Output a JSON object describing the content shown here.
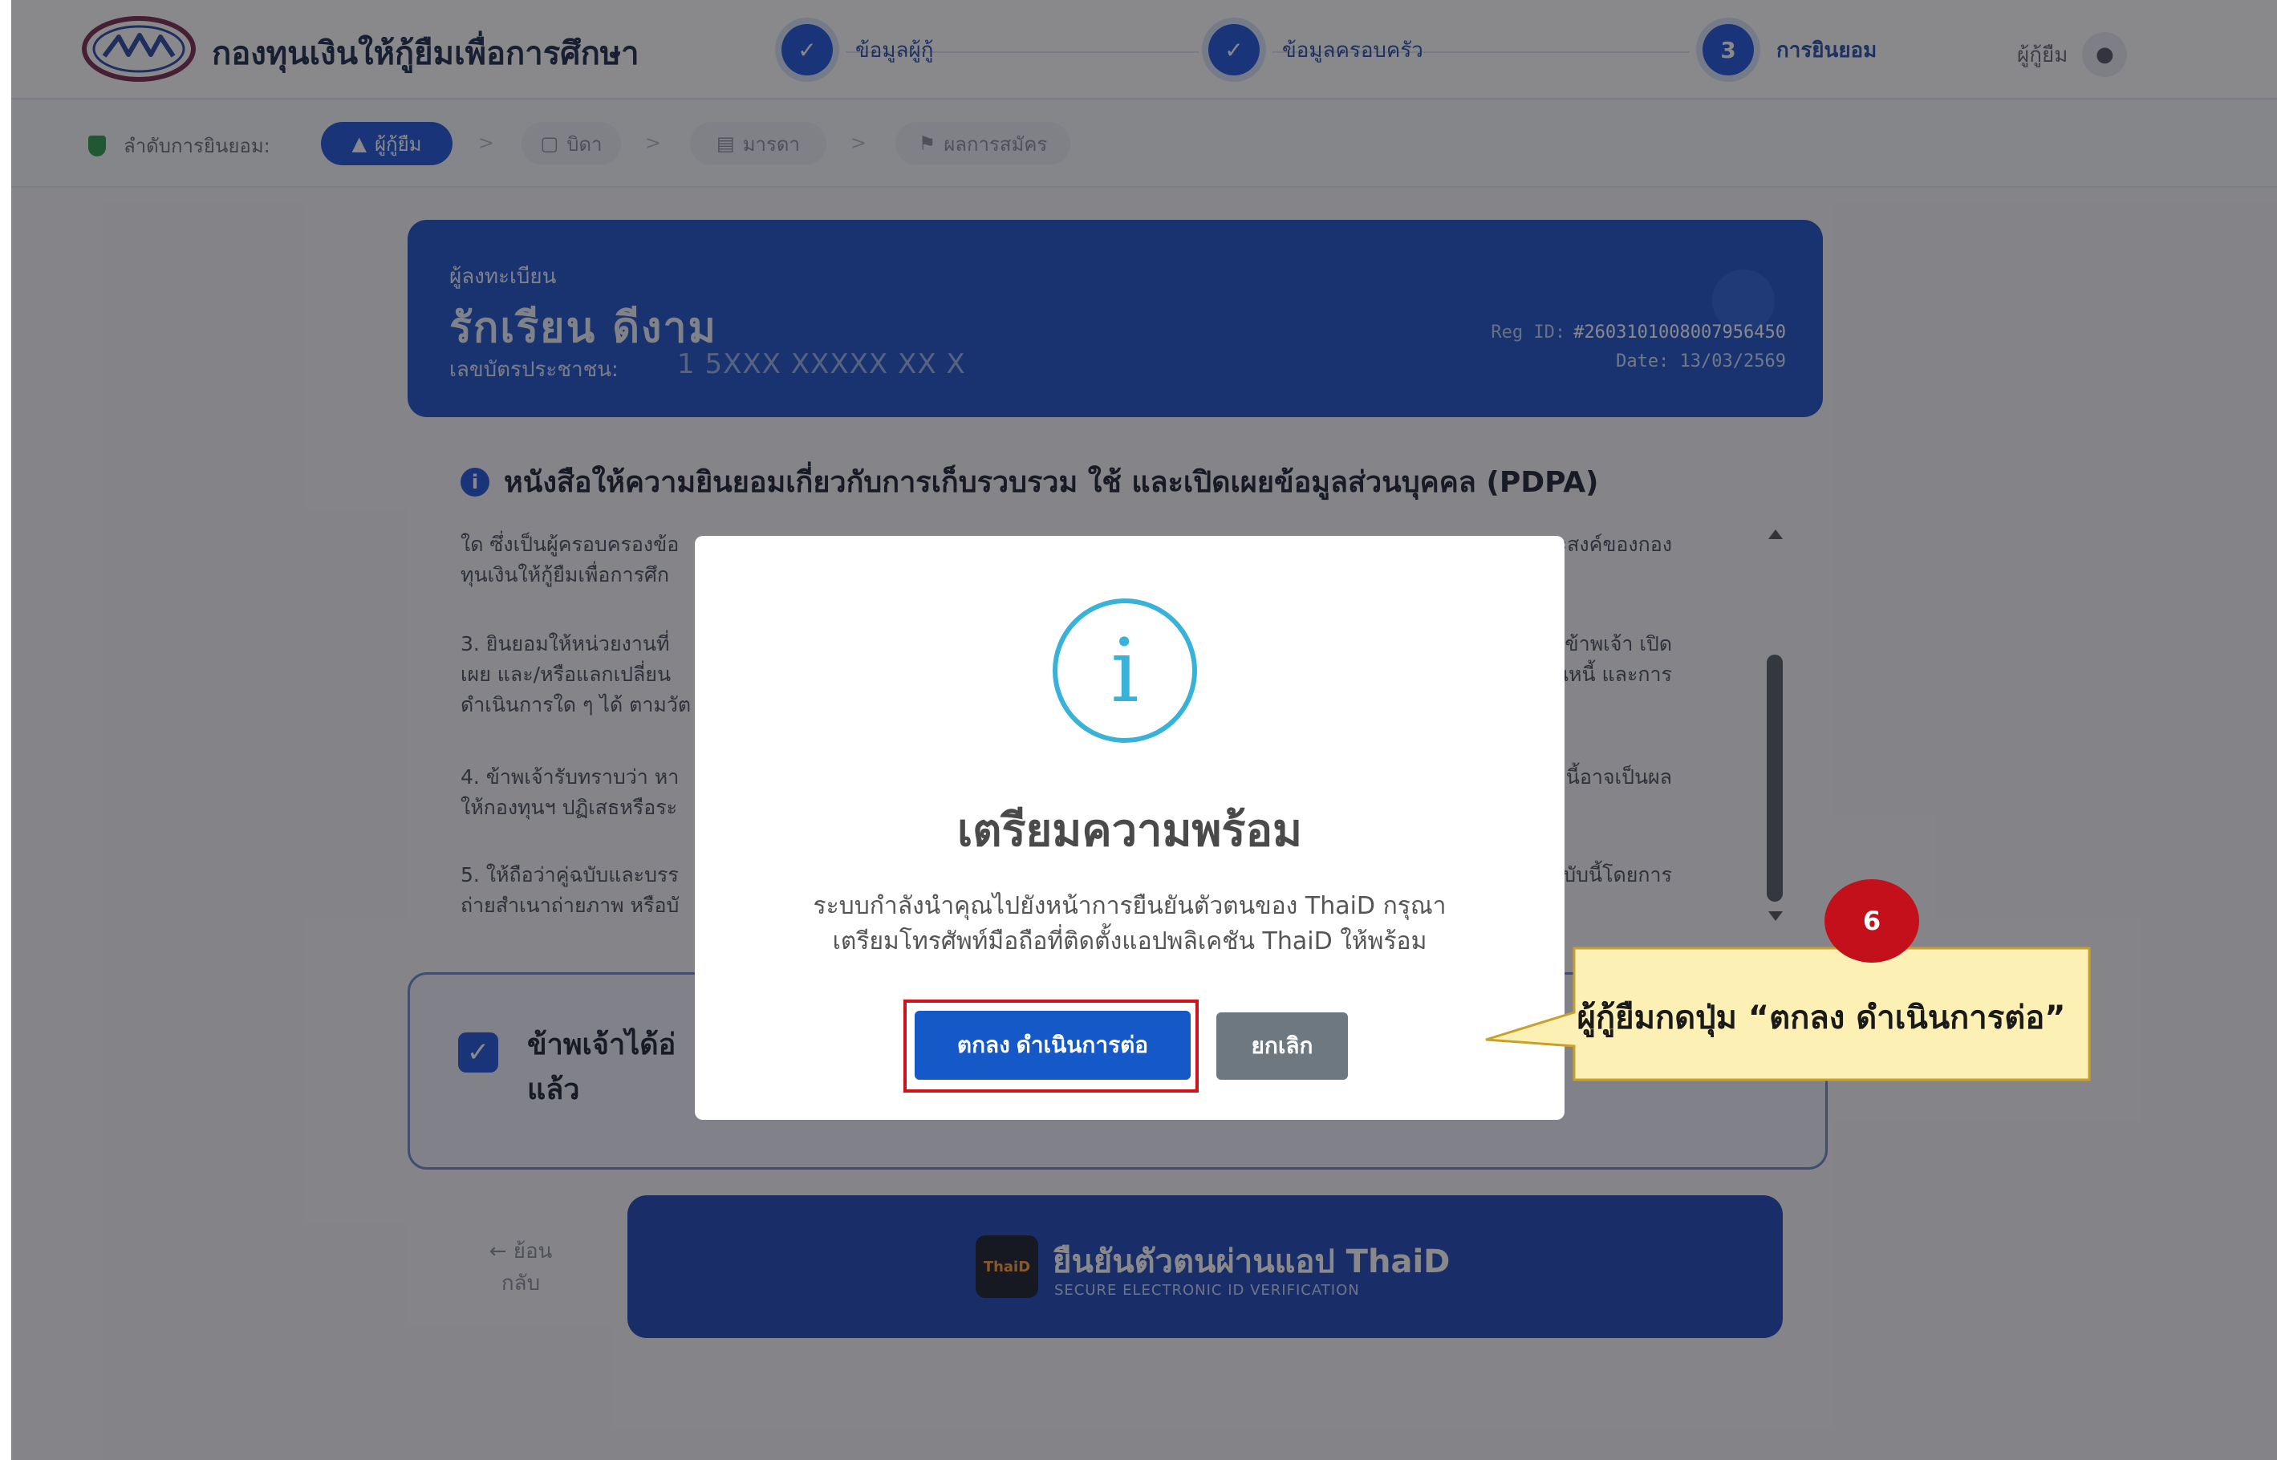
{
  "header": {
    "org_name": "กองทุนเงินให้กู้ยืมเพื่อการศึกษา",
    "steps": [
      {
        "marker": "✓",
        "label": "ข้อมูลผู้กู้"
      },
      {
        "marker": "✓",
        "label": "ข้อมูลครอบครัว"
      },
      {
        "marker": "3",
        "label": "การยินยอม"
      }
    ],
    "user_label": "ผู้กู้ยืม",
    "user_icon": "user-icon"
  },
  "subnav": {
    "label": "ลำดับการยินยอม:",
    "pills": [
      "ผู้กู้ยืม",
      "บิดา",
      "มารดา",
      "ผลการสมัคร"
    ],
    "pill_icons": [
      "user-icon",
      "calendar-icon",
      "id-card-icon",
      "flag-icon"
    ],
    "separator": ">"
  },
  "registrant": {
    "heading": "ผู้ลงทะเบียน",
    "name": "รักเรียน  ดีงาม",
    "id_label": "เลขบัตรประชาชน:",
    "id_value": "1 5XXX XXXXX XX X",
    "reg_id_label": "Reg ID:",
    "reg_id_value": "#2603101008007956450",
    "date": "Date: 13/03/2569"
  },
  "consent": {
    "title": "หนังสือให้ความยินยอมเกี่ยวกับการเก็บรวบรวม ใช้ และเปิดเผยข้อมูลส่วนบุคคล (PDPA)",
    "paragraphs": [
      {
        "left": [
          "ใด ซึ่งเป็นผู้ครอบครองข้อ",
          "ทุนเงินให้กู้ยืมเพื่อการศึก"
        ],
        "right": [
          "ประสงค์ของกอง"
        ]
      },
      {
        "left": [
          "3. ยินยอมให้หน่วยงานที่",
          "เผย และ/หรือแลกเปลี่ยน",
          "ดำเนินการใด ๆ ได้ ตามวัต"
        ],
        "right": [
          "ของข้าพเจ้า เปิด",
          "งานหนี้ และการ"
        ]
      },
      {
        "left": [
          "4. ข้าพเจ้ารับทราบว่า หา",
          "ให้กองทุนฯ ปฏิเสธหรือระ"
        ],
        "right": [
          "ฉบับนี้อาจเป็นผล"
        ]
      },
      {
        "left": [
          "5. ให้ถือว่าคู่ฉบับและบรร",
          "ถ่ายสำเนาถ่ายภาพ หรือบั"
        ],
        "right": [
          "มฉบับนี้โดยการ"
        ]
      }
    ],
    "agree_text": "ข้าพเจ้าได้อ่ แล้ว"
  },
  "footer": {
    "back_label": "← ย้อนกลับ",
    "thaid_logo": "ThaiD",
    "thaid_main": "ยืนยันตัวตนผ่านแอป ThaiD",
    "thaid_sub": "SECURE ELECTRONIC ID VERIFICATION"
  },
  "modal": {
    "icon": "info-icon",
    "icon_glyph": "i",
    "title": "เตรียมความพร้อม",
    "body_line1": "ระบบกำลังนำคุณไปยังหน้าการยืนยันตัวตนของ ThaiD กรุณา",
    "body_line2": "เตรียมโทรศัพท์มือถือที่ติดตั้งแอปพลิเคชัน ThaiD ให้พร้อม",
    "confirm_label": "ตกลง ดำเนินการต่อ",
    "cancel_label": "ยกเลิก"
  },
  "annotation": {
    "step_number": "6",
    "callout_text": "ผู้กู้ยืมกดปุ่ม “ตกลง ดำเนินการต่อ”"
  },
  "colors": {
    "primary": "#1f55d6",
    "card": "#1f52c9",
    "info": "#38b2d8",
    "highlight": "#d2121b",
    "callout_fill": "#fdf0b4",
    "callout_border": "#c9a12a"
  }
}
